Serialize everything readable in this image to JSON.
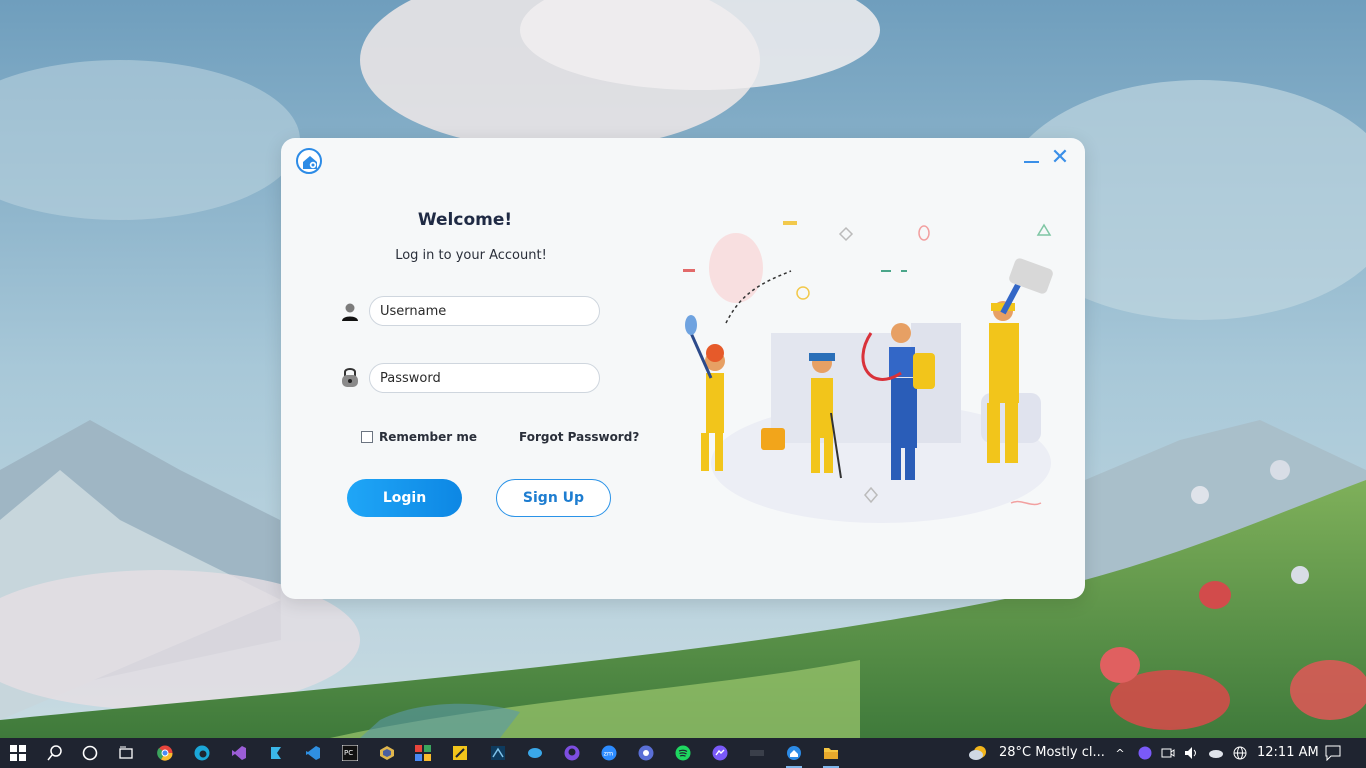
{
  "window": {
    "title_icon": "home-gear-icon",
    "minimize_icon": "minimize-icon",
    "close_icon": "close-icon"
  },
  "login": {
    "heading": "Welcome!",
    "subheading": "Log in to your Account!",
    "username_placeholder": "Username",
    "password_placeholder": "Password",
    "remember_label": "Remember me",
    "forgot_label": "Forgot Password?",
    "login_label": "Login",
    "signup_label": "Sign Up"
  },
  "colors": {
    "accent": "#1a96ef",
    "heading": "#1f2a44"
  },
  "taskbar": {
    "apps": [
      "start-icon",
      "search-icon",
      "cortana-icon",
      "task-view-icon",
      "chrome-icon",
      "edge-icon",
      "visual-studio-icon",
      "app-icon",
      "vscode-icon",
      "pycharm-icon",
      "app-icon",
      "app-icon",
      "app-icon",
      "app-icon",
      "app-icon",
      "github-icon",
      "zoom-icon",
      "app-icon",
      "spotify-icon",
      "messenger-icon",
      "app-icon",
      "app-icon",
      "file-explorer-icon"
    ],
    "weather": "28°C  Mostly cl...",
    "time": "12:11 AM"
  }
}
